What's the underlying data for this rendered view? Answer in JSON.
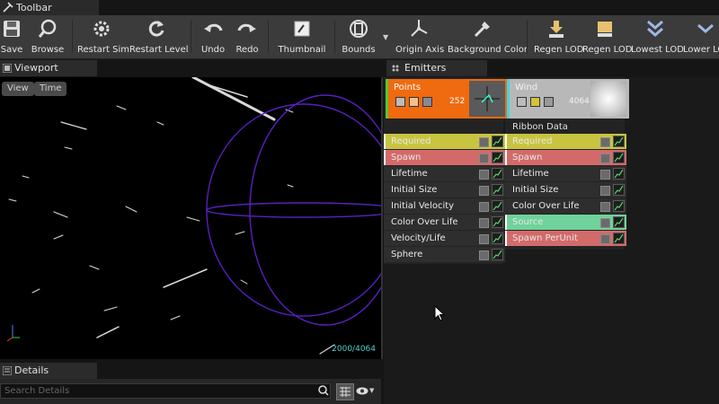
{
  "toolbar_tab": {
    "label": "Toolbar"
  },
  "toolbar": {
    "buttons": [
      {
        "key": "save",
        "label": "Save"
      },
      {
        "key": "browse",
        "label": "Browse"
      },
      {
        "key": "restart_sim",
        "label": "Restart Sim"
      },
      {
        "key": "restart_level",
        "label": "Restart Level"
      },
      {
        "key": "undo",
        "label": "Undo"
      },
      {
        "key": "redo",
        "label": "Redo"
      },
      {
        "key": "thumbnail",
        "label": "Thumbnail"
      },
      {
        "key": "bounds",
        "label": "Bounds"
      },
      {
        "key": "origin_axis",
        "label": "Origin Axis"
      },
      {
        "key": "background_color",
        "label": "Background Color"
      },
      {
        "key": "regen_lod_1",
        "label": "Regen LOD"
      },
      {
        "key": "regen_lod_2",
        "label": "Regen LOD"
      },
      {
        "key": "lowest_lod",
        "label": "Lowest LOD"
      },
      {
        "key": "lower_lod",
        "label": "Lower LOD"
      }
    ]
  },
  "viewport": {
    "tab_label": "Viewport",
    "view_button": "View",
    "time_button": "Time",
    "particle_count": "2000/4064"
  },
  "details": {
    "tab_label": "Details",
    "search_placeholder": "Search Details"
  },
  "emitters": {
    "tab_label": "Emitters",
    "columns": [
      {
        "name": "Points",
        "count": "252",
        "color": "#f06a10",
        "modules": [
          {
            "label": "Required",
            "color": "#c8c440"
          },
          {
            "label": "Spawn",
            "color": "#d36a6a"
          },
          {
            "label": "Lifetime",
            "color": "#2e2e2e"
          },
          {
            "label": "Initial Size",
            "color": "#2e2e2e"
          },
          {
            "label": "Initial Velocity",
            "color": "#2e2e2e"
          },
          {
            "label": "Color Over Life",
            "color": "#2e2e2e"
          },
          {
            "label": "Velocity/Life",
            "color": "#2e2e2e"
          },
          {
            "label": "Sphere",
            "color": "#2e2e2e"
          }
        ]
      },
      {
        "name": "Wind",
        "count": "4064",
        "type_label": "Ribbon Data",
        "color": "#b8b8b8",
        "modules": [
          {
            "label": "Required",
            "color": "#c8c440"
          },
          {
            "label": "Spawn",
            "color": "#d36a6a"
          },
          {
            "label": "Lifetime",
            "color": "#2e2e2e"
          },
          {
            "label": "Initial Size",
            "color": "#2e2e2e"
          },
          {
            "label": "Color Over Life",
            "color": "#2e2e2e"
          },
          {
            "label": "Source",
            "color": "#6fd29a"
          },
          {
            "label": "Spawn PerUnit",
            "color": "#d36a6a"
          }
        ]
      }
    ]
  }
}
